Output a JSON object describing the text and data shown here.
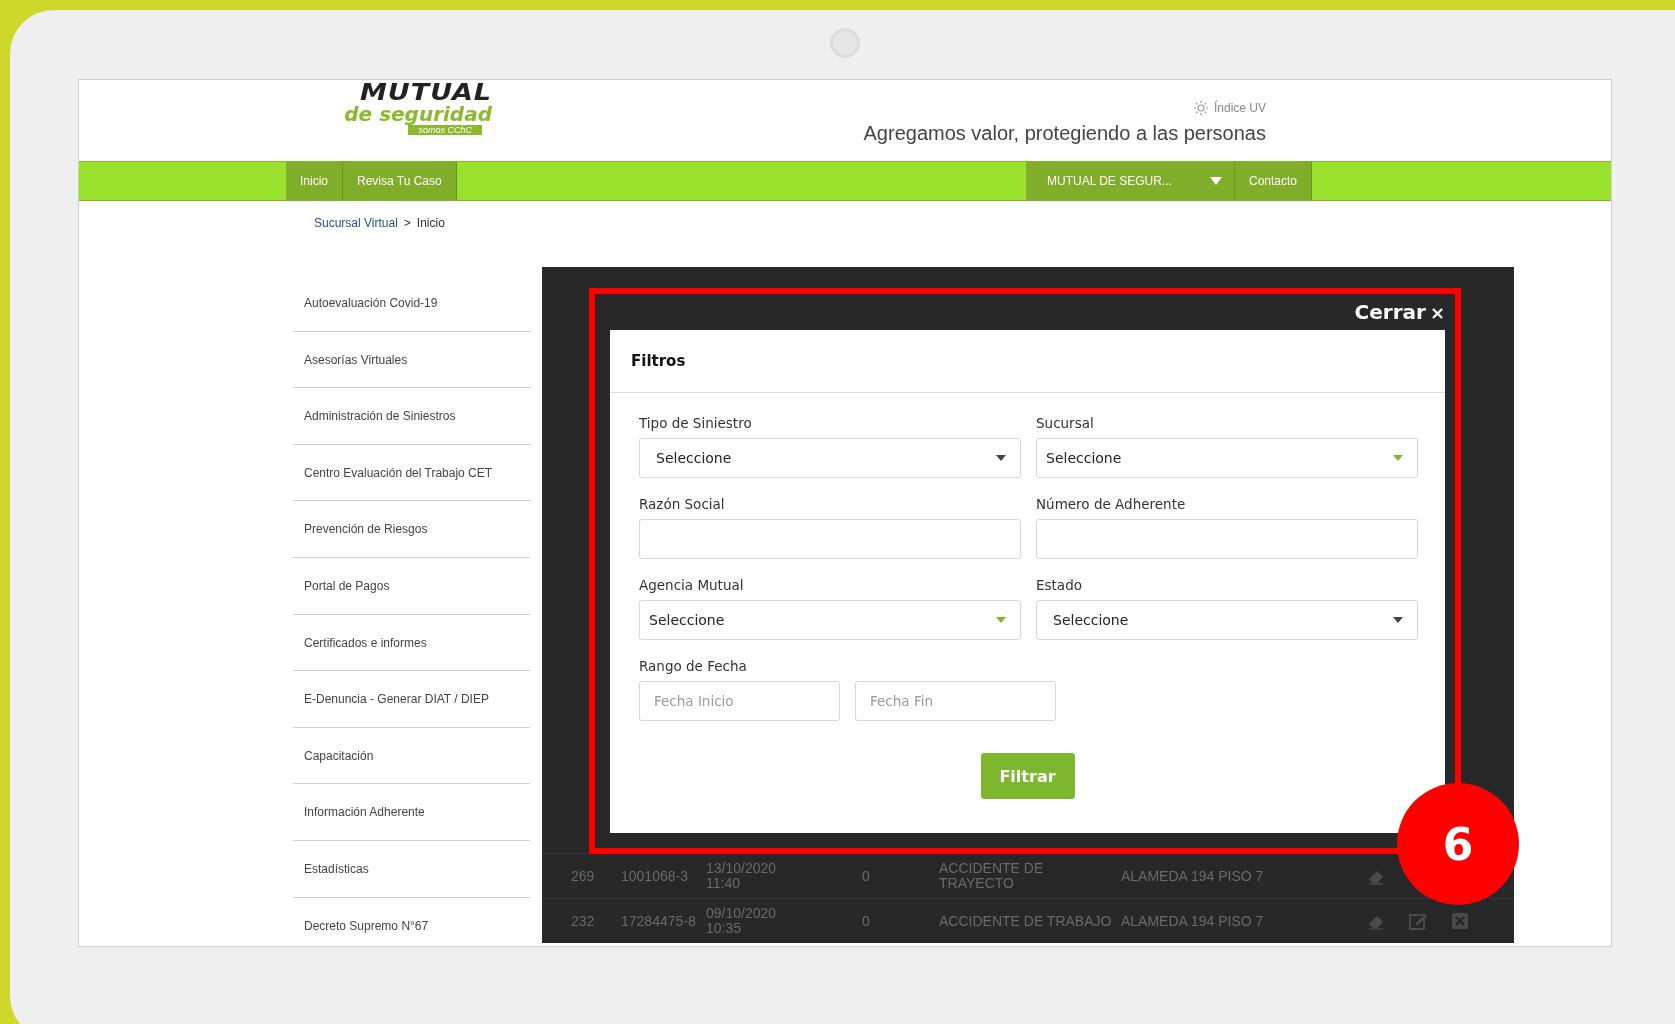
{
  "logo": {
    "name": "MUTUAL",
    "subtitle": "de seguridad",
    "tag": "somos CChC"
  },
  "header": {
    "uv_link": "Índice UV",
    "tagline": "Agregamos valor, protegiendo a las personas"
  },
  "nav": {
    "items": [
      {
        "label": "Inicio"
      },
      {
        "label": "Revisa Tu Caso"
      }
    ],
    "dropdown": "MUTUAL DE SEGUR...",
    "contact": "Contacto"
  },
  "breadcrumb": {
    "link": "Sucursal Virtual",
    "separator": ">",
    "current": "Inicio"
  },
  "sidebar": {
    "items": [
      {
        "label": "Autoevaluación Covid-19"
      },
      {
        "label": "Asesorías Virtuales"
      },
      {
        "label": "Administración de Siniestros"
      },
      {
        "label": "Centro Evaluación del Trabajo CET"
      },
      {
        "label": "Prevención de Riesgos"
      },
      {
        "label": "Portal de Pagos"
      },
      {
        "label": "Certificados e informes"
      },
      {
        "label": "E-Denuncia - Generar DIAT / DIEP"
      },
      {
        "label": "Capacitación"
      },
      {
        "label": "Información Adherente"
      },
      {
        "label": "Estadísticas"
      },
      {
        "label": "Decreto Supremo N°67"
      }
    ]
  },
  "background_table": {
    "rows": [
      {
        "cells": [
          "269",
          "1001068-3",
          "13/10/2020\n11:40",
          "0",
          "ACCIDENTE DE\nTRAYECTO",
          "ALAMEDA 194 PISO 7"
        ],
        "actions": [
          {
            "kind": "eraser"
          }
        ]
      },
      {
        "cells": [
          "232",
          "17284475-8",
          "09/10/2020\n10:35",
          "0",
          "ACCIDENTE DE TRABAJO",
          "ALAMEDA 194 PISO 7"
        ],
        "actions": [
          {
            "kind": "eraser"
          },
          {
            "kind": "edit"
          },
          {
            "kind": "delete"
          }
        ]
      }
    ]
  },
  "modal": {
    "close": "Cerrar",
    "close_icon": "×",
    "title": "Filtros",
    "fields": [
      {
        "kind": "select",
        "label": "Tipo de Siniestro",
        "value": "Seleccione"
      },
      {
        "kind": "select-accent",
        "label": "Sucursal",
        "value": "Seleccione"
      },
      {
        "kind": "text",
        "label": "Razón Social"
      },
      {
        "kind": "text",
        "label": "Número de Adherente"
      },
      {
        "kind": "select-accent",
        "label": "Agencia Mutual",
        "value": "Seleccione"
      },
      {
        "kind": "select",
        "label": "Estado",
        "value": "Seleccione"
      },
      {
        "kind": "date-range",
        "label": "Rango de Fecha",
        "inputs": [
          {
            "placeholder": "Fecha Inicio"
          },
          {
            "placeholder": "Fecha Fin"
          }
        ]
      }
    ],
    "button": "Filtrar"
  },
  "annotation": {
    "number": "6"
  }
}
